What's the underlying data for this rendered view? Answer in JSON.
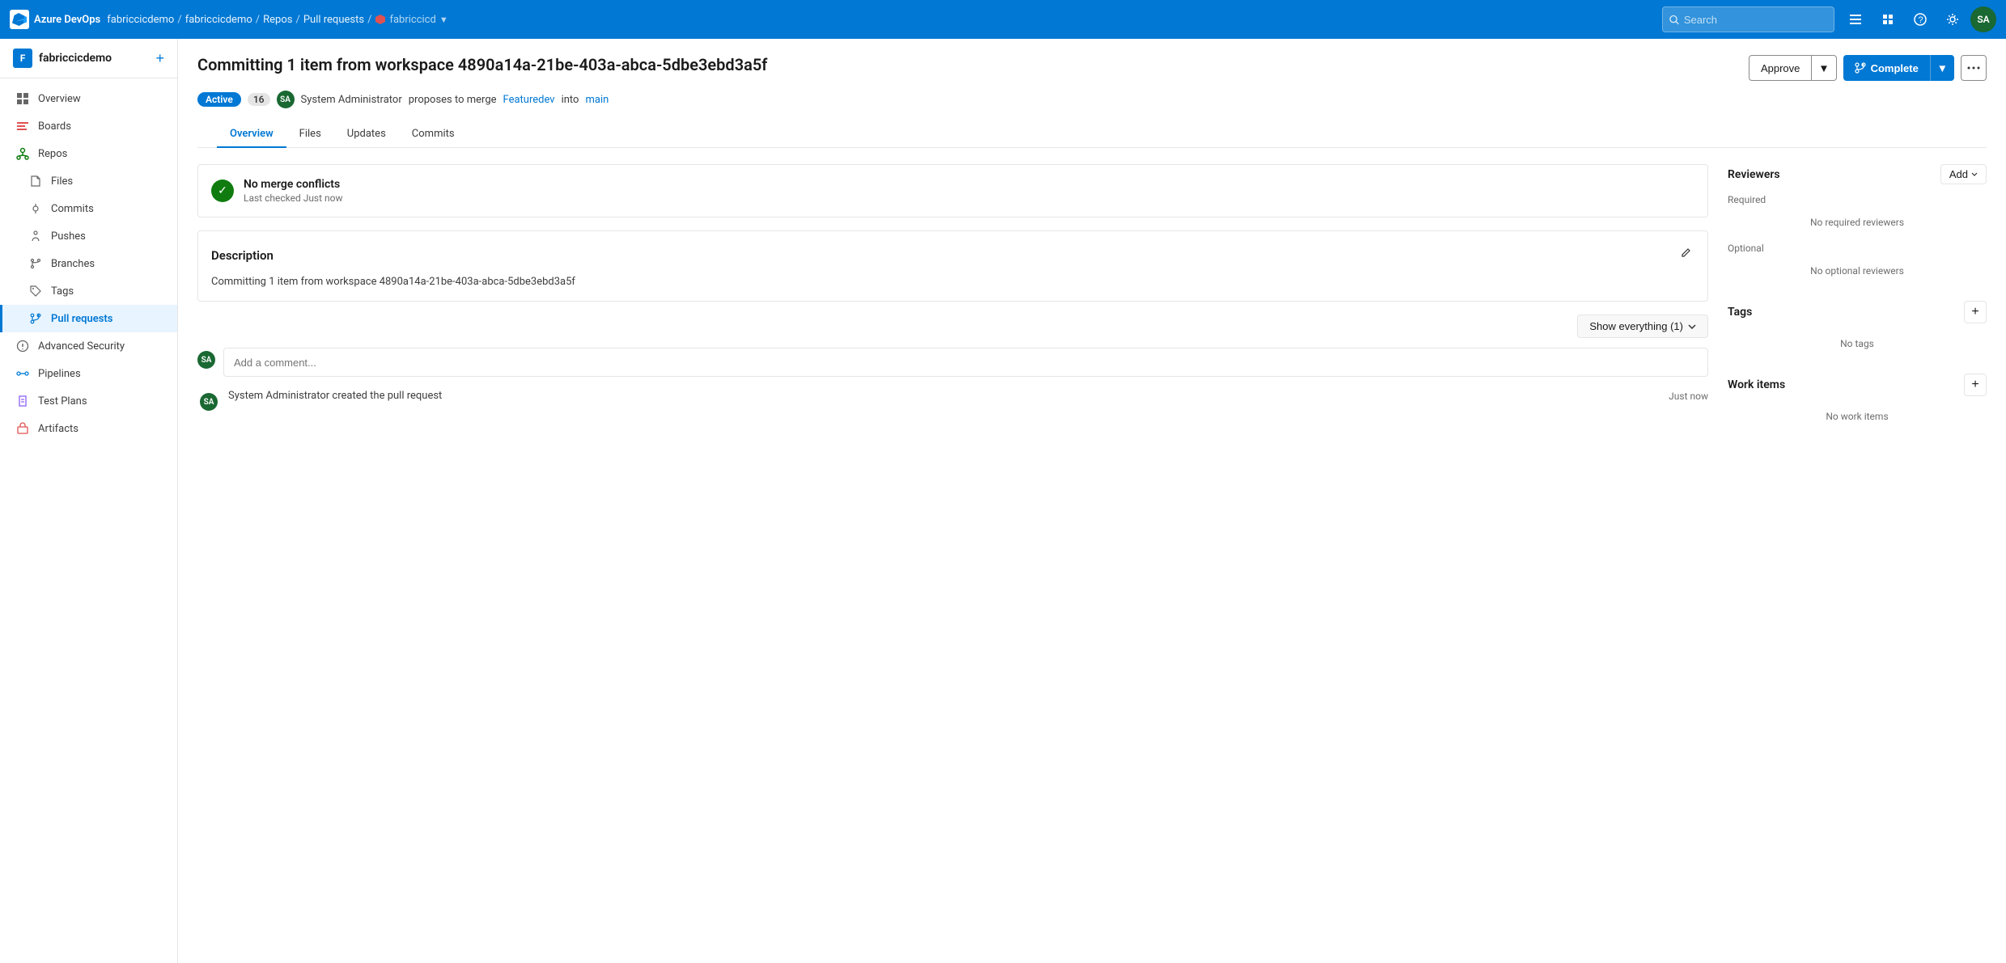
{
  "app": {
    "name": "Azure DevOps",
    "brand_initials": "F"
  },
  "breadcrumb": {
    "org": "fabriccicdemo",
    "project": "fabriccicdemo",
    "repos_label": "Repos",
    "pr_label": "Pull requests",
    "repo_name": "fabriccicd"
  },
  "search": {
    "placeholder": "Search"
  },
  "header_icons": {
    "settings_label": "SA"
  },
  "sidebar": {
    "project_name": "fabriccicdemo",
    "items": [
      {
        "id": "overview",
        "label": "Overview"
      },
      {
        "id": "boards",
        "label": "Boards"
      },
      {
        "id": "repos",
        "label": "Repos"
      },
      {
        "id": "files",
        "label": "Files"
      },
      {
        "id": "commits",
        "label": "Commits"
      },
      {
        "id": "pushes",
        "label": "Pushes"
      },
      {
        "id": "branches",
        "label": "Branches"
      },
      {
        "id": "tags",
        "label": "Tags"
      },
      {
        "id": "pull-requests",
        "label": "Pull requests",
        "active": true
      },
      {
        "id": "advanced-security",
        "label": "Advanced Security"
      },
      {
        "id": "pipelines",
        "label": "Pipelines"
      },
      {
        "id": "test-plans",
        "label": "Test Plans"
      },
      {
        "id": "artifacts",
        "label": "Artifacts"
      }
    ]
  },
  "pr": {
    "title": "Committing 1 item from workspace 4890a14a-21be-403a-abca-5dbe3ebd3a5f",
    "status": "Active",
    "vote_count": "16",
    "author_initials": "SA",
    "author_name": "System Administrator",
    "action_text": "proposes to merge",
    "source_branch": "Featuredev",
    "into_text": "into",
    "target_branch": "main",
    "approve_label": "Approve",
    "complete_label": "Complete",
    "tabs": [
      {
        "id": "overview",
        "label": "Overview",
        "active": true
      },
      {
        "id": "files",
        "label": "Files"
      },
      {
        "id": "updates",
        "label": "Updates"
      },
      {
        "id": "commits",
        "label": "Commits"
      }
    ],
    "no_conflicts": {
      "title": "No merge conflicts",
      "subtitle": "Last checked Just now"
    },
    "description": {
      "section_title": "Description",
      "text": "Committing 1 item from workspace 4890a14a-21be-403a-abca-5dbe3ebd3a5f"
    },
    "show_everything_label": "Show everything (1)",
    "comment_placeholder": "Add a comment...",
    "activity": [
      {
        "id": "created",
        "author_initials": "SA",
        "text": "System Administrator created the pull request",
        "time": "Just now"
      }
    ]
  },
  "right_panel": {
    "reviewers": {
      "title": "Reviewers",
      "add_label": "Add",
      "required_label": "Required",
      "required_empty": "No required reviewers",
      "optional_label": "Optional",
      "optional_empty": "No optional reviewers"
    },
    "tags": {
      "title": "Tags",
      "empty": "No tags"
    },
    "work_items": {
      "title": "Work items",
      "empty": "No work items"
    }
  }
}
